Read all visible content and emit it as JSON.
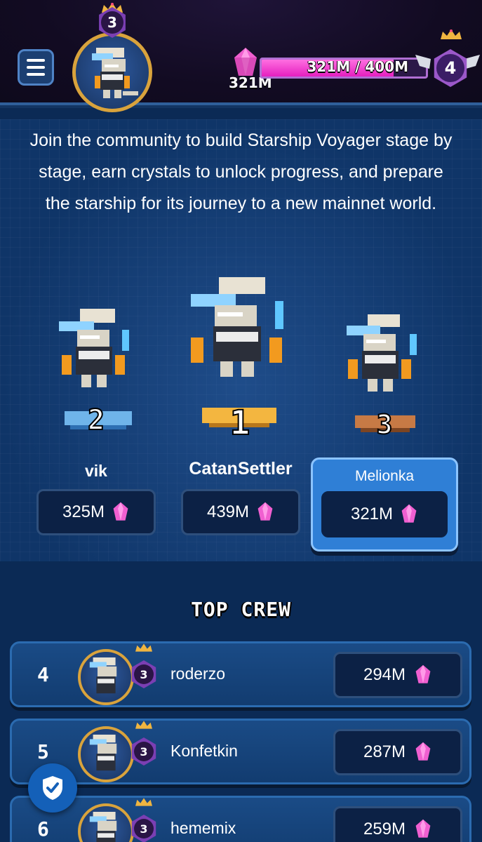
{
  "header": {
    "menu_icon": "hamburger-icon",
    "player_level": "3",
    "crystal_count": "321M",
    "progress_text": "321M / 400M",
    "progress_fraction": 0.8025,
    "next_level": "4"
  },
  "intro_text": "Join the community to build Starship Voyager stage by stage, earn crystals to unlock progress, and prepare the starship for its journey to a new mainnet world.",
  "podium": {
    "first": {
      "rank": "1",
      "name": "CatanSettler",
      "score": "439M"
    },
    "second": {
      "rank": "2",
      "name": "vik",
      "score": "325M"
    },
    "third": {
      "rank": "3",
      "name": "Melionka",
      "score": "321M"
    }
  },
  "section_title": "TOP CREW",
  "crew": [
    {
      "rank": "4",
      "level": "3",
      "name": "roderzo",
      "score": "294M"
    },
    {
      "rank": "5",
      "level": "3",
      "name": "Konfetkin",
      "score": "287M"
    },
    {
      "rank": "6",
      "level": "3",
      "name": "hememix",
      "score": "259M"
    }
  ],
  "colors": {
    "accent_pink": "#ff6fe1",
    "gold": "#d9a33c",
    "panel_blue": "#0f3568",
    "highlight_blue": "#2f7fd6"
  },
  "icons": {
    "crystal": "crystal-icon",
    "shield": "shield-check-icon"
  }
}
